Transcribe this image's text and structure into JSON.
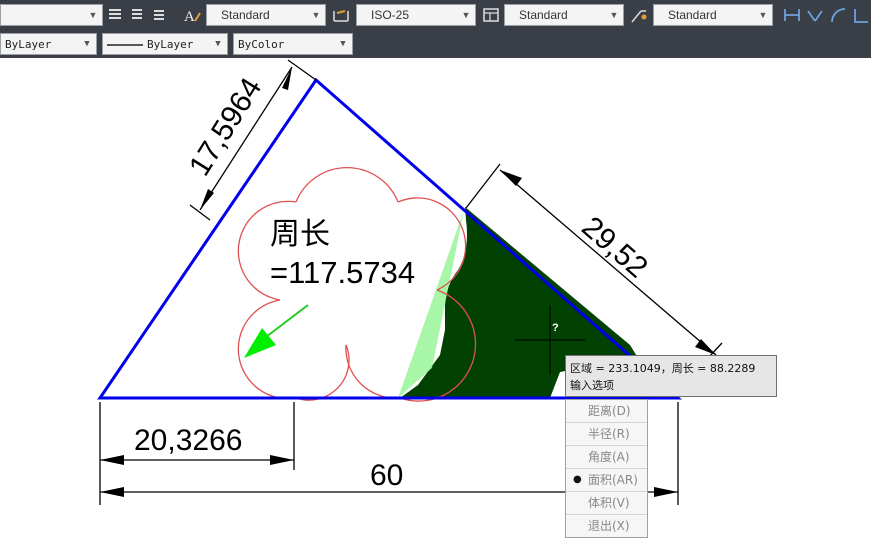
{
  "toolbar": {
    "text_style": "Standard",
    "dim_style": "ISO-25",
    "table_style": "Standard",
    "mleader_style": "Standard"
  },
  "properties": {
    "layer": "ByLayer",
    "linetype": "ByLayer",
    "color": "ByColor"
  },
  "drawing": {
    "dim_left_side": "17,5964",
    "dim_right_side": "29,52",
    "dim_base_partial": "20,3266",
    "dim_base_total": "60",
    "perimeter_label": "周长",
    "perimeter_value": "=117.5734",
    "cursor_mark": "?",
    "colors": {
      "triangle": "#0000ee",
      "flower": "#e05050",
      "fill": "#014101",
      "highlight": "#66ff66"
    }
  },
  "tooltip": {
    "line1": "区域 = 233.1049，周长 = 88.2289",
    "line2": "输入选项"
  },
  "menu": {
    "items": [
      {
        "label": "距离(D)",
        "selected": false
      },
      {
        "label": "半径(R)",
        "selected": false
      },
      {
        "label": "角度(A)",
        "selected": false
      },
      {
        "label": "面积(AR)",
        "selected": true
      },
      {
        "label": "体积(V)",
        "selected": false
      },
      {
        "label": "退出(X)",
        "selected": false
      }
    ],
    "bullet": "●"
  }
}
